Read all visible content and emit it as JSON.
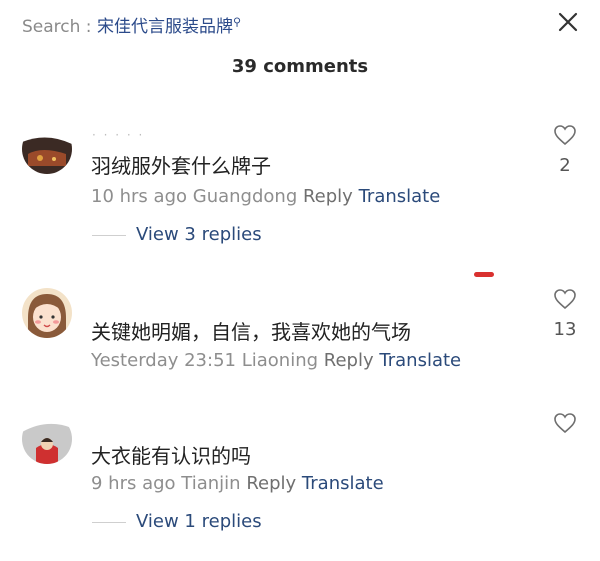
{
  "search": {
    "label": "Search : ",
    "query": "宋佳代言服装品牌"
  },
  "comments_count": "39 comments",
  "comments": [
    {
      "text": "羽绒服外套什么牌子",
      "time": "10 hrs ago",
      "location": "Guangdong",
      "reply_label": "Reply",
      "translate_label": "Translate",
      "likes": "2",
      "replies_label": "View 3 replies"
    },
    {
      "text": "关键她明媚，自信，我喜欢她的气场",
      "time": "Yesterday 23:51",
      "location": "Liaoning",
      "reply_label": "Reply",
      "translate_label": "Translate",
      "likes": "13"
    },
    {
      "text": "大衣能有认识的吗",
      "time": "9 hrs ago",
      "location": "Tianjin",
      "reply_label": "Reply",
      "translate_label": "Translate",
      "replies_label": "View 1 replies"
    }
  ],
  "icons": {
    "close": "close-icon",
    "like": "heart-outline-icon",
    "search_mark": "search-icon"
  },
  "colors": {
    "link": "#2b4a7a",
    "meta": "#8e8e8e",
    "accent_red": "#d9312f"
  }
}
